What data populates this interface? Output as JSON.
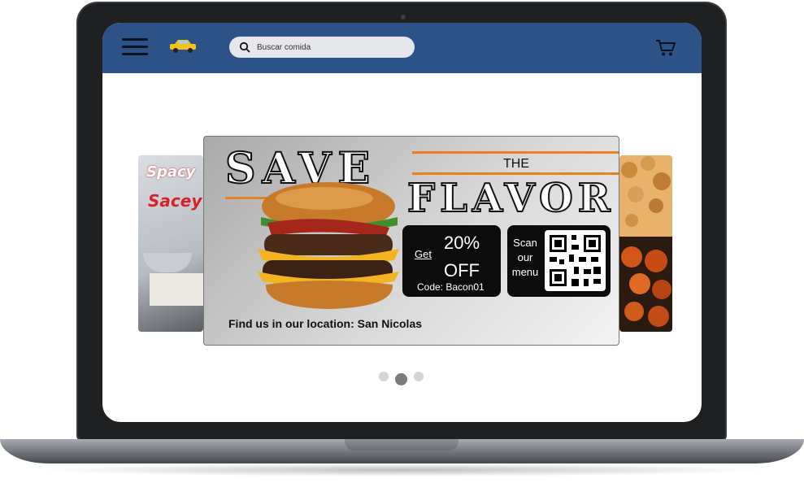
{
  "search": {
    "placeholder": "Buscar comida"
  },
  "banner": {
    "headline_1": "SAVE",
    "headline_2": "THE",
    "headline_3": "FLAVOR",
    "promo_get": "Get",
    "promo_percent": "20%",
    "promo_off": "OFF",
    "promo_code": "Code: Bacon01",
    "qr_text": "Scan our menu",
    "location_text": "Find us in our location: San Nicolas"
  },
  "left_card": {
    "text_1": "Spacy",
    "text_2": "Sacey"
  },
  "carousel": {
    "slides": 3,
    "active_index": 1
  },
  "icons": [
    "hamburger-menu-icon",
    "taxi-logo-icon",
    "search-icon",
    "cart-icon",
    "burger-image",
    "qr-code-icon"
  ],
  "colors": {
    "header": "#2d5287",
    "accent": "#e8811f",
    "promo_bg": "#0c0c0c"
  }
}
